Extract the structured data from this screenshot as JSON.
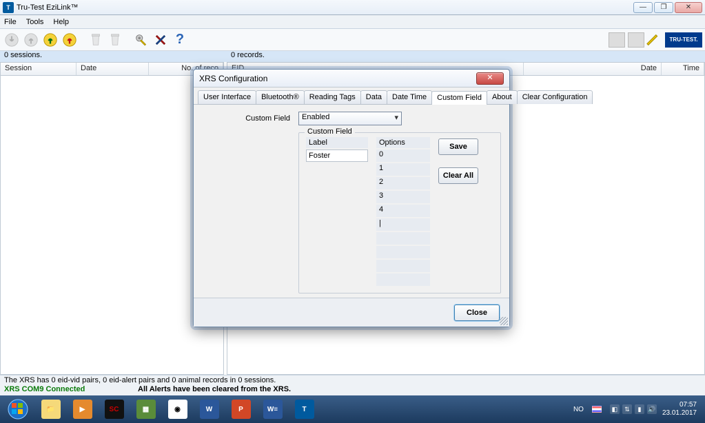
{
  "window": {
    "title": "Tru-Test EziLink™",
    "menu": {
      "file": "File",
      "tools": "Tools",
      "help": "Help"
    },
    "win_controls": {
      "min": "—",
      "max": "❐",
      "close": "✕"
    }
  },
  "status": {
    "sessions": "0 sessions.",
    "records": "0 records."
  },
  "left_grid": {
    "cols": {
      "session": "Session",
      "date": "Date",
      "norec": "No. of reco"
    }
  },
  "right_grid": {
    "cols": {
      "eid": "EID",
      "date": "Date",
      "time": "Time"
    }
  },
  "bottom": {
    "summary": "The XRS has 0 eid-vid pairs, 0 eid-alert pairs and 0 animal records in 0 sessions.",
    "connection": "XRS COM9 Connected",
    "alerts": "All Alerts have been cleared from the XRS."
  },
  "dialog": {
    "title": "XRS Configuration",
    "tabs": {
      "ui": "User Interface",
      "bt": "Bluetooth®",
      "rt": "Reading Tags",
      "data": "Data",
      "dt": "Date Time",
      "cf": "Custom Field",
      "about": "About",
      "clear": "Clear Configuration"
    },
    "cf_label": "Custom Field",
    "cf_value": "Enabled",
    "group_title": "Custom Field",
    "hdr_label": "Label",
    "hdr_options": "Options",
    "label_value": "Foster",
    "options": [
      "0",
      "1",
      "2",
      "3",
      "4",
      "|",
      "",
      "",
      "",
      ""
    ],
    "save": "Save",
    "clear_all": "Clear All",
    "close": "Close"
  },
  "toolbar": {
    "help_glyph": "?"
  },
  "brand": "TRU-TEST.",
  "taskbar": {
    "lang": "NO",
    "time": "07:57",
    "date": "23.01.2017"
  }
}
